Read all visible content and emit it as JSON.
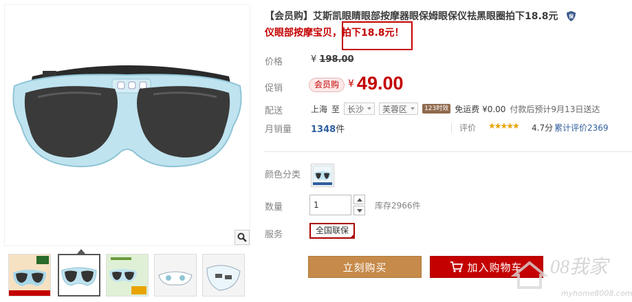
{
  "product": {
    "title": "【会员购】艾斯凯眼睛眼部按摩器眼保姆眼保仪祛黑眼圈拍下18.8元",
    "subtitle_prefix": "仪眼部按摩宝贝，",
    "subtitle_highlight": "拍下18.8元！"
  },
  "price": {
    "label": "价格",
    "currency": "¥",
    "original": "198.00"
  },
  "promo": {
    "label": "促销",
    "tag": "会员购",
    "currency": "¥",
    "price": "49.00"
  },
  "shipping": {
    "label": "配送",
    "from": "上海",
    "to_word": "至",
    "city": "长沙",
    "district": "芙蓉区",
    "speed_tag": "123时效",
    "fee": "免运费 ¥0.00",
    "estimate": "付款后预计9月13日送达"
  },
  "sales": {
    "label": "月销量",
    "count": "1348",
    "unit": "件",
    "rating_label": "评价",
    "stars": "★★★★★",
    "rating": "4.7分",
    "reviews": "累计评价2369"
  },
  "color": {
    "label": "颜色分类"
  },
  "quantity": {
    "label": "数量",
    "value": "1",
    "stock": "库存2966件"
  },
  "service": {
    "label": "服务",
    "option": "全国联保"
  },
  "actions": {
    "buy_now": "立刻购买",
    "add_to_cart": "加入购物车"
  },
  "watermark": {
    "brand": "08我家",
    "url": "myhome8008.com"
  },
  "colors": {
    "accent": "#c40000",
    "buy_button": "#c68a4a",
    "link": "#2f5e9e",
    "star": "#e8a400",
    "goggle_frame": "#bfe3ef"
  }
}
